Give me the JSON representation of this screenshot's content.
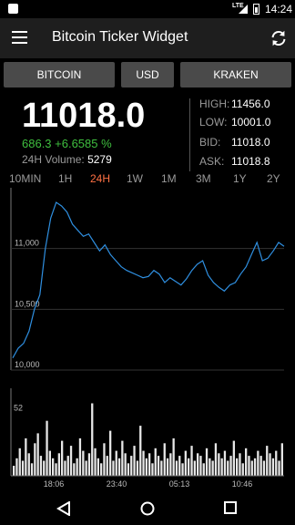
{
  "status_bar": {
    "network": "LTE",
    "time": "14:24"
  },
  "app_bar": {
    "title": "Bitcoin Ticker Widget",
    "menu_icon": "menu-icon",
    "refresh_icon": "refresh-icon"
  },
  "selectors": {
    "coin": "BITCOIN",
    "currency": "USD",
    "exchange": "KRAKEN"
  },
  "ticker": {
    "price": "11018.0",
    "change": "686.3 +6.6585 %",
    "volume_label": "24H Volume:",
    "volume_value": "5279"
  },
  "stats": [
    {
      "label": "HIGH:",
      "value": "11456.0"
    },
    {
      "label": "LOW:",
      "value": "10001.0"
    },
    {
      "label": "BID:",
      "value": "11018.0"
    },
    {
      "label": "ASK:",
      "value": "11018.8"
    }
  ],
  "ranges": [
    "10MIN",
    "1H",
    "24H",
    "1W",
    "1M",
    "3M",
    "1Y",
    "2Y"
  ],
  "active_range": "24H",
  "colors": {
    "price_line": "#2f8fe0",
    "change_positive": "#3fbf3f",
    "active_range": "#ff7043",
    "volume_bars": "#e6e6e6"
  },
  "chart_data": [
    {
      "type": "line",
      "name": "price",
      "y_ticks": [
        "11,000",
        "10,500",
        "10,000"
      ],
      "ylim": [
        10000,
        11456
      ],
      "x": [
        0,
        2,
        4,
        6,
        8,
        10,
        12,
        14,
        16,
        18,
        20,
        22,
        24,
        26,
        28,
        30,
        32,
        34,
        36,
        38,
        40,
        42,
        44,
        46,
        48,
        50,
        52,
        54,
        56,
        58,
        60,
        62,
        64,
        66,
        68,
        70,
        72,
        74,
        76,
        78,
        80,
        82,
        84,
        86,
        88,
        90,
        92,
        94,
        96,
        98,
        100
      ],
      "values": [
        10100,
        10180,
        10220,
        10320,
        10500,
        10620,
        11000,
        11250,
        11380,
        11350,
        11300,
        11200,
        11150,
        11100,
        11120,
        11050,
        10980,
        11030,
        10950,
        10900,
        10850,
        10820,
        10800,
        10780,
        10760,
        10770,
        10820,
        10790,
        10720,
        10760,
        10730,
        10700,
        10750,
        10820,
        10870,
        10900,
        10780,
        10720,
        10680,
        10650,
        10700,
        10720,
        10790,
        10850,
        10950,
        11050,
        10900,
        10920,
        10980,
        11050,
        11018
      ]
    },
    {
      "type": "bar",
      "name": "volume",
      "y_ticks": [
        "52"
      ],
      "x_ticks": [
        "18:06",
        "23:40",
        "05:13",
        "10:46"
      ],
      "values": [
        8,
        14,
        22,
        12,
        30,
        18,
        10,
        26,
        34,
        16,
        12,
        44,
        20,
        14,
        10,
        18,
        28,
        12,
        16,
        24,
        10,
        14,
        30,
        20,
        12,
        18,
        58,
        22,
        14,
        10,
        26,
        16,
        36,
        12,
        20,
        14,
        28,
        18,
        10,
        16,
        24,
        12,
        40,
        20,
        14,
        18,
        10,
        22,
        16,
        12,
        26,
        14,
        18,
        30,
        12,
        16,
        10,
        20,
        14,
        24,
        12,
        18,
        16,
        10,
        22,
        14,
        12,
        26,
        18,
        14,
        20,
        12,
        16,
        28,
        14,
        18,
        10,
        22,
        16,
        12,
        14,
        20,
        16,
        12,
        24,
        18,
        14,
        20,
        12,
        26
      ]
    }
  ]
}
